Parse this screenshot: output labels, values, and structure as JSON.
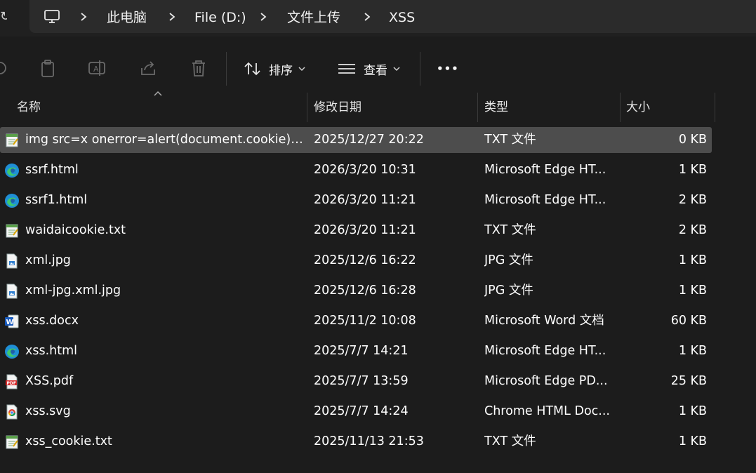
{
  "breadcrumb": [
    "此电脑",
    "File (D:)",
    "文件上传",
    "XSS"
  ],
  "toolbar": {
    "sort_label": "排序",
    "view_label": "查看",
    "more_label": "•••"
  },
  "columns": {
    "name": "名称",
    "date": "修改日期",
    "type": "类型",
    "size": "大小"
  },
  "files": [
    {
      "name": "img src=x onerror=alert(document.cookie).t...",
      "date": "2025/12/27 20:22",
      "type": "TXT 文件",
      "size": "0 KB",
      "icon": "txt-file-icon",
      "selected": true
    },
    {
      "name": "ssrf.html",
      "date": "2026/3/20 10:31",
      "type": "Microsoft Edge HT...",
      "size": "1 KB",
      "icon": "edge-file-icon"
    },
    {
      "name": "ssrf1.html",
      "date": "2026/3/20 11:21",
      "type": "Microsoft Edge HT...",
      "size": "2 KB",
      "icon": "edge-file-icon"
    },
    {
      "name": "waidaicookie.txt",
      "date": "2026/3/20 11:21",
      "type": "TXT 文件",
      "size": "2 KB",
      "icon": "txt-file-icon"
    },
    {
      "name": "xml.jpg",
      "date": "2025/12/6 16:22",
      "type": "JPG 文件",
      "size": "1 KB",
      "icon": "jpg-file-icon"
    },
    {
      "name": "xml-jpg.xml.jpg",
      "date": "2025/12/6 16:28",
      "type": "JPG 文件",
      "size": "1 KB",
      "icon": "jpg-file-icon"
    },
    {
      "name": "xss.docx",
      "date": "2025/11/2 10:08",
      "type": "Microsoft Word 文档",
      "size": "60 KB",
      "icon": "word-file-icon"
    },
    {
      "name": "xss.html",
      "date": "2025/7/7 14:21",
      "type": "Microsoft Edge HT...",
      "size": "1 KB",
      "icon": "edge-file-icon"
    },
    {
      "name": "XSS.pdf",
      "date": "2025/7/7 13:59",
      "type": "Microsoft Edge PD...",
      "size": "25 KB",
      "icon": "pdf-file-icon"
    },
    {
      "name": "xss.svg",
      "date": "2025/7/7 14:24",
      "type": "Chrome HTML Doc...",
      "size": "1 KB",
      "icon": "chrome-file-icon"
    },
    {
      "name": "xss_cookie.txt",
      "date": "2025/11/13 21:53",
      "type": "TXT 文件",
      "size": "1 KB",
      "icon": "txt-file-icon"
    }
  ],
  "colors": {
    "background": "#1c1c1c",
    "addressbar": "#2b2b2b",
    "selected_row": "#4d4d4d",
    "text": "#ffffff"
  }
}
